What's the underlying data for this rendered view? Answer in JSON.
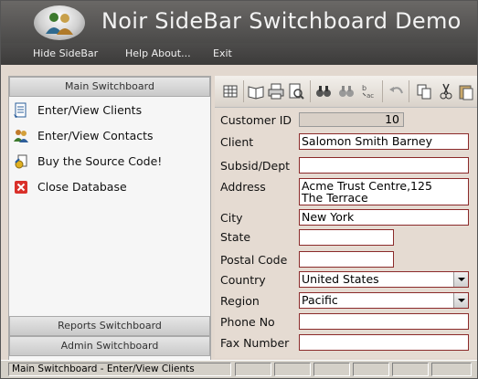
{
  "app": {
    "title": "Noir SideBar Switchboard Demo"
  },
  "menu": {
    "items": [
      "Hide SideBar",
      "Help About...",
      "Exit"
    ]
  },
  "sidebar": {
    "main_header": "Main Switchboard",
    "items": [
      {
        "label": "Enter/View Clients",
        "icon": "document-icon"
      },
      {
        "label": "Enter/View Contacts",
        "icon": "people-icon"
      },
      {
        "label": "Buy the Source Code!",
        "icon": "buy-icon"
      },
      {
        "label": "Close Database",
        "icon": "close-icon"
      }
    ],
    "reports_header": "Reports Switchboard",
    "admin_header": "Admin Switchboard"
  },
  "toolbar": {
    "buttons": [
      "datasheet-icon",
      "open-book-icon",
      "print-icon",
      "print-preview-icon",
      "find-icon",
      "find-next-icon",
      "replace-icon",
      "undo-icon",
      "copy-icon",
      "cut-icon",
      "paste-icon"
    ]
  },
  "form": {
    "customer_id": {
      "label": "Customer ID",
      "value": "10"
    },
    "client": {
      "label": "Client",
      "value": "Salomon Smith Barney"
    },
    "subsid": {
      "label": "Subsid/Dept",
      "value": ""
    },
    "address": {
      "label": "Address",
      "value": "Acme Trust Centre,125\nThe Terrace"
    },
    "city": {
      "label": "City",
      "value": "New York"
    },
    "state": {
      "label": "State",
      "value": ""
    },
    "postal": {
      "label": "Postal Code",
      "value": ""
    },
    "country": {
      "label": "Country",
      "value": "United States"
    },
    "region": {
      "label": "Region",
      "value": "Pacific"
    },
    "phone": {
      "label": "Phone No",
      "value": ""
    },
    "fax": {
      "label": "Fax Number",
      "value": ""
    }
  },
  "status": {
    "text": "Main Switchboard - Enter/View Clients"
  },
  "colors": {
    "field_border": "#8b2a2a",
    "header_bg": "#4b4a49"
  }
}
